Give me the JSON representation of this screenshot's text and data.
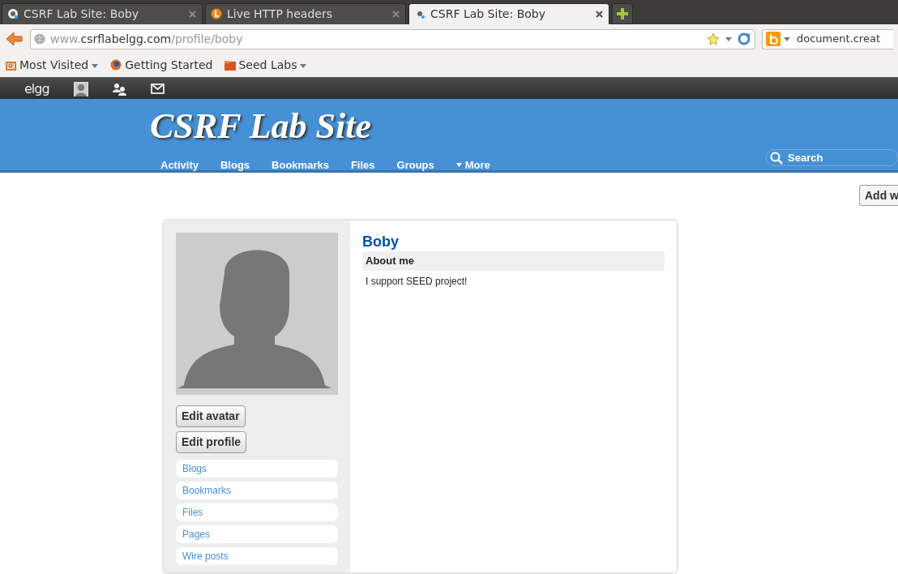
{
  "browser": {
    "tabs": [
      {
        "title": "CSRF Lab Site: Boby",
        "kind": "site",
        "selected": false
      },
      {
        "title": "Live HTTP headers",
        "kind": "addon",
        "selected": false
      },
      {
        "title": "CSRF Lab Site: Boby",
        "kind": "site",
        "selected": true
      }
    ],
    "url": {
      "prefix": "www.",
      "domain": "csrflabelgg.com",
      "path": "/profile/boby"
    },
    "search_engine_field": {
      "value": "document.creat"
    },
    "bookmarks": [
      {
        "label": "Most Visited",
        "kind": "smartfolder",
        "dropdown": true
      },
      {
        "label": "Getting Started",
        "kind": "page",
        "dropdown": false
      },
      {
        "label": "Seed Labs",
        "kind": "folder",
        "dropdown": true
      }
    ]
  },
  "topbar": {
    "logo": "elgg"
  },
  "site": {
    "title": "CSRF Lab Site",
    "menu": [
      {
        "label": "Activity",
        "caret": false
      },
      {
        "label": "Blogs",
        "caret": false
      },
      {
        "label": "Bookmarks",
        "caret": false
      },
      {
        "label": "Files",
        "caret": false
      },
      {
        "label": "Groups",
        "caret": false
      },
      {
        "label": "More",
        "caret": true
      }
    ],
    "search": {
      "placeholder": "Search"
    },
    "add_widgets_button": "Add w"
  },
  "profile": {
    "name": "Boby",
    "buttons": [
      "Edit avatar",
      "Edit profile"
    ],
    "links": [
      "Blogs",
      "Bookmarks",
      "Files",
      "Pages",
      "Wire posts"
    ],
    "about_heading": "About me",
    "about_text": "I support SEED project!"
  }
}
